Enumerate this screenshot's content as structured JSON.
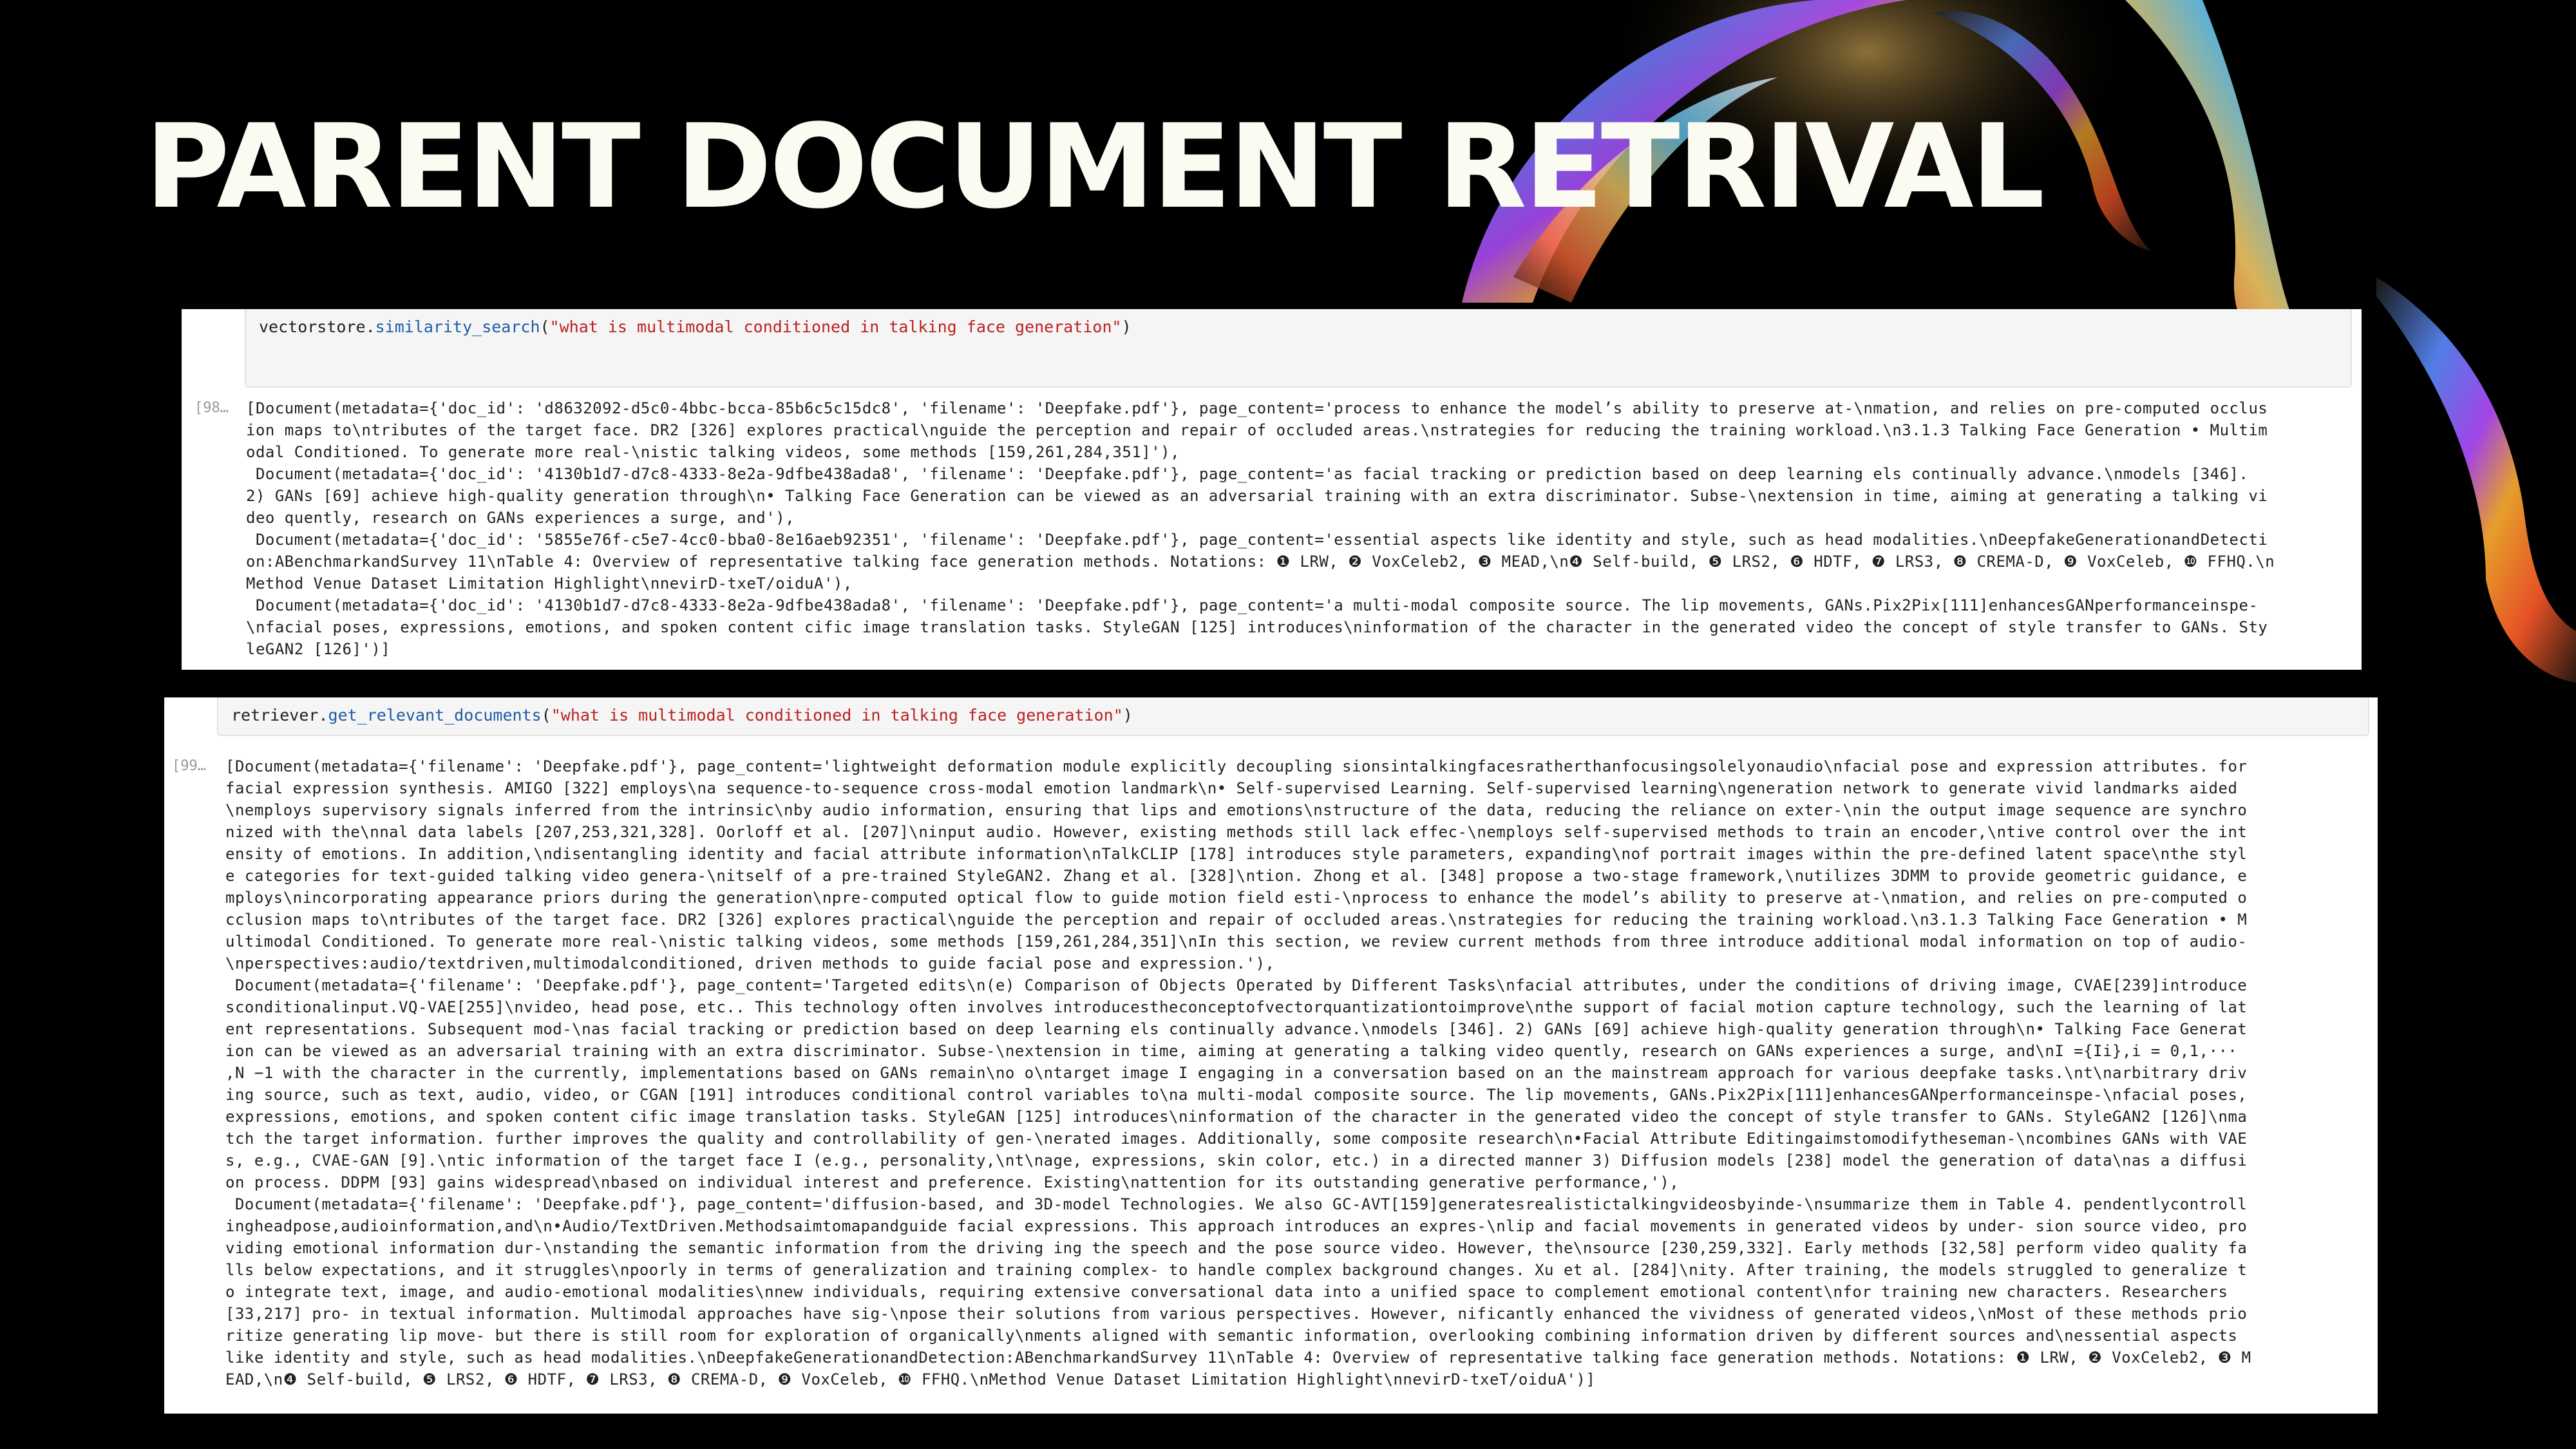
{
  "slide": {
    "title": "PARENT DOCUMENT RETRIVAL"
  },
  "cell1": {
    "code_prefix": "vectorstore.",
    "code_method": "similarity_search",
    "code_open": "(",
    "code_arg": "\"what is multimodal conditioned in talking face generation\"",
    "code_close": ")",
    "prompt": "[98…",
    "output_lines": [
      "[Document(metadata={'doc_id': 'd8632092-d5c0-4bbc-bcca-85b6c5c15dc8', 'filename': 'Deepfake.pdf'}, page_content='process to enhance the model’s ability to preserve at-\\nmation, and relies on pre-computed occlus",
      "ion maps to\\ntributes of the target face. DR2 [326] explores practical\\nguide the perception and repair of occluded areas.\\nstrategies for reducing the training workload.\\n3.1.3 Talking Face Generation • Multim",
      "odal Conditioned. To generate more real-\\nistic talking videos, some methods [159,261,284,351]'),",
      " Document(metadata={'doc_id': '4130b1d7-d7c8-4333-8e2a-9dfbe438ada8', 'filename': 'Deepfake.pdf'}, page_content='as facial tracking or prediction based on deep learning els continually advance.\\nmodels [346].",
      "2) GANs [69] achieve high-quality generation through\\n• Talking Face Generation can be viewed as an adversarial training with an extra discriminator. Subse-\\nextension in time, aiming at generating a talking vi",
      "deo quently, research on GANs experiences a surge, and'),",
      " Document(metadata={'doc_id': '5855e76f-c5e7-4cc0-bba0-8e16aeb92351', 'filename': 'Deepfake.pdf'}, page_content='essential aspects like identity and style, such as head modalities.\\nDeepfakeGenerationandDetecti",
      "on:ABenchmarkandSurvey 11\\nTable 4: Overview of representative talking face generation methods. Notations: ❶ LRW, ❷ VoxCeleb2, ❸ MEAD,\\n❹ Self-build, ❺ LRS2, ❻ HDTF, ❼ LRS3, ❽ CREMA-D, ❾ VoxCeleb, ❿ FFHQ.\\n",
      "Method Venue Dataset Limitation Highlight\\nnevirD-txeT/oiduA'),",
      " Document(metadata={'doc_id': '4130b1d7-d7c8-4333-8e2a-9dfbe438ada8', 'filename': 'Deepfake.pdf'}, page_content='a multi-modal composite source. The lip movements, GANs.Pix2Pix[111]enhancesGANperformanceinspe-",
      "\\nfacial poses, expressions, emotions, and spoken content cific image translation tasks. StyleGAN [125] introduces\\ninformation of the character in the generated video the concept of style transfer to GANs. Sty",
      "leGAN2 [126]')]"
    ]
  },
  "cell2": {
    "code_prefix": "retriever.",
    "code_method": "get_relevant_documents",
    "code_open": "(",
    "code_arg": "\"what is multimodal conditioned in talking face generation\"",
    "code_close": ")",
    "prompt": "[99…",
    "output_lines": [
      "[Document(metadata={'filename': 'Deepfake.pdf'}, page_content='lightweight deformation module explicitly decoupling sionsintalkingfacesratherthanfocusingsolelyonaudio\\nfacial pose and expression attributes. for",
      "facial expression synthesis. AMIGO [322] employs\\na sequence-to-sequence cross-modal emotion landmark\\n• Self-supervised Learning. Self-supervised learning\\ngeneration network to generate vivid landmarks aided",
      "\\nemploys supervisory signals inferred from the intrinsic\\nby audio information, ensuring that lips and emotions\\nstructure of the data, reducing the reliance on exter-\\nin the output image sequence are synchro",
      "nized with the\\nnal data labels [207,253,321,328]. Oorloff et al. [207]\\ninput audio. However, existing methods still lack effec-\\nemploys self-supervised methods to train an encoder,\\ntive control over the int",
      "ensity of emotions. In addition,\\ndisentangling identity and facial attribute information\\nTalkCLIP [178] introduces style parameters, expanding\\nof portrait images within the pre-defined latent space\\nthe styl",
      "e categories for text-guided talking video genera-\\nitself of a pre-trained StyleGAN2. Zhang et al. [328]\\ntion. Zhong et al. [348] propose a two-stage framework,\\nutilizes 3DMM to provide geometric guidance, e",
      "mploys\\nincorporating appearance priors during the generation\\npre-computed optical flow to guide motion field esti-\\nprocess to enhance the model’s ability to preserve at-\\nmation, and relies on pre-computed o",
      "cclusion maps to\\ntributes of the target face. DR2 [326] explores practical\\nguide the perception and repair of occluded areas.\\nstrategies for reducing the training workload.\\n3.1.3 Talking Face Generation • M",
      "ultimodal Conditioned. To generate more real-\\nistic talking videos, some methods [159,261,284,351]\\nIn this section, we review current methods from three introduce additional modal information on top of audio-",
      "\\nperspectives:audio/textdriven,multimodalconditioned, driven methods to guide facial pose and expression.'),",
      " Document(metadata={'filename': 'Deepfake.pdf'}, page_content='Targeted edits\\n(e) Comparison of Objects Operated by Different Tasks\\nfacial attributes, under the conditions of driving image, CVAE[239]introduce",
      "sconditionalinput.VQ-VAE[255]\\nvideo, head pose, etc.. This technology often involves introducestheconceptofvectorquantizationtoimprove\\nthe support of facial motion capture technology, such the learning of lat",
      "ent representations. Subsequent mod-\\nas facial tracking or prediction based on deep learning els continually advance.\\nmodels [346]. 2) GANs [69] achieve high-quality generation through\\n• Talking Face Generat",
      "ion can be viewed as an adversarial training with an extra discriminator. Subse-\\nextension in time, aiming at generating a talking video quently, research on GANs experiences a surge, and\\nI ={Ii},i = 0,1,···",
      ",N −1 with the character in the currently, implementations based on GANs remain\\no o\\ntarget image I engaging in a conversation based on an the mainstream approach for various deepfake tasks.\\nt\\narbitrary driv",
      "ing source, such as text, audio, video, or CGAN [191] introduces conditional control variables to\\na multi-modal composite source. The lip movements, GANs.Pix2Pix[111]enhancesGANperformanceinspe-\\nfacial poses,",
      "expressions, emotions, and spoken content cific image translation tasks. StyleGAN [125] introduces\\ninformation of the character in the generated video the concept of style transfer to GANs. StyleGAN2 [126]\\nma",
      "tch the target information. further improves the quality and controllability of gen-\\nerated images. Additionally, some composite research\\n•Facial Attribute Editingaimstomodifytheseman-\\ncombines GANs with VAE",
      "s, e.g., CVAE-GAN [9].\\ntic information of the target face I (e.g., personality,\\nt\\nage, expressions, skin color, etc.) in a directed manner 3) Diffusion models [238] model the generation of data\\nas a diffusi",
      "on process. DDPM [93] gains widespread\\nbased on individual interest and preference. Existing\\nattention for its outstanding generative performance,'),",
      " Document(metadata={'filename': 'Deepfake.pdf'}, page_content='diffusion-based, and 3D-model Technologies. We also GC-AVT[159]generatesrealistictalkingvideosbyinde-\\nsummarize them in Table 4. pendentlycontroll",
      "ingheadpose,audioinformation,and\\n•Audio/TextDriven.Methodsaimtomapandguide facial expressions. This approach introduces an expres-\\nlip and facial movements in generated videos by under- sion source video, pro",
      "viding emotional information dur-\\nstanding the semantic information from the driving ing the speech and the pose source video. However, the\\nsource [230,259,332]. Early methods [32,58] perform video quality fa",
      "lls below expectations, and it struggles\\npoorly in terms of generalization and training complex- to handle complex background changes. Xu et al. [284]\\nity. After training, the models struggled to generalize t",
      "o integrate text, image, and audio-emotional modalities\\nnew individuals, requiring extensive conversational data into a unified space to complement emotional content\\nfor training new characters. Researchers",
      "[33,217] pro- in textual information. Multimodal approaches have sig-\\npose their solutions from various perspectives. However, nificantly enhanced the vividness of generated videos,\\nMost of these methods prio",
      "ritize generating lip move- but there is still room for exploration of organically\\nments aligned with semantic information, overlooking combining information driven by different sources and\\nessential aspects",
      "like identity and style, such as head modalities.\\nDeepfakeGenerationandDetection:ABenchmarkandSurvey 11\\nTable 4: Overview of representative talking face generation methods. Notations: ❶ LRW, ❷ VoxCeleb2, ❸ M",
      "EAD,\\n❹ Self-build, ❺ LRS2, ❻ HDTF, ❼ LRS3, ❽ CREMA-D, ❾ VoxCeleb, ❿ FFHQ.\\nMethod Venue Dataset Limitation Highlight\\nnevirD-txeT/oiduA')]"
    ]
  }
}
